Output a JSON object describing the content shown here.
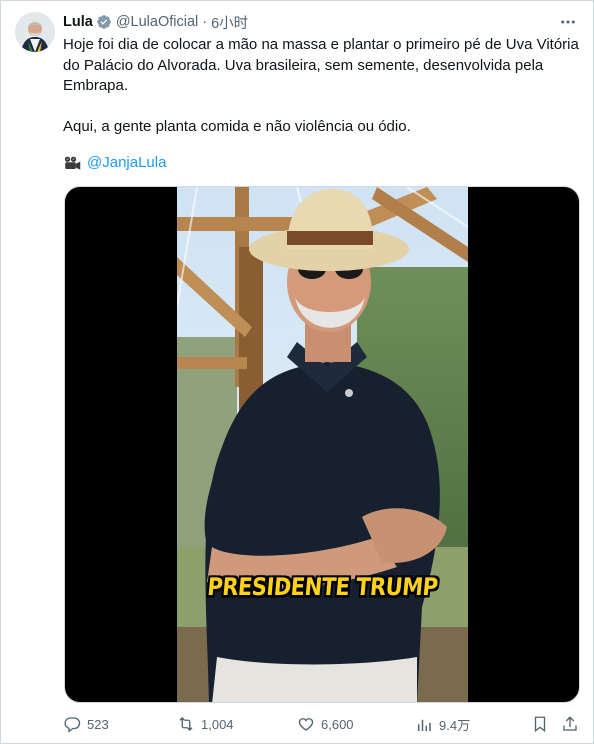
{
  "tweet": {
    "author_name": "Lula",
    "handle": "@LulaOficial",
    "separator": "·",
    "time": "6小时",
    "text_line1": "Hoje foi dia de colocar a mão na massa e plantar o primeiro pé de Uva Vitória do Palácio do Alvorada. Uva brasileira, sem semente, desenvolvida pela Embrapa.",
    "text_line2": "Aqui, a gente planta comida e não violência ou ódio.",
    "mention_icon": "movie-camera-icon",
    "mention": "@JanjaLula"
  },
  "media": {
    "caption": "PRESIDENTE TRUMP"
  },
  "actions": {
    "replies": "523",
    "retweets": "1,004",
    "likes": "6,600",
    "views": "9.4万"
  },
  "colors": {
    "link": "#1d9bf0",
    "secondary_text": "#536471",
    "verified_badge": "#829aab",
    "caption_yellow": "#ffd21a"
  }
}
